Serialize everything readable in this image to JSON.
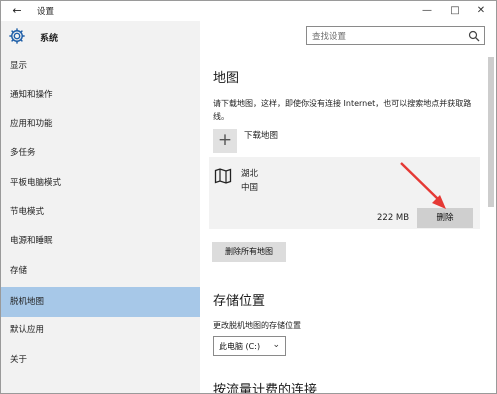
{
  "window": {
    "title": "设置",
    "controls": [
      "minimize",
      "maximize",
      "close"
    ]
  },
  "sidebar": {
    "header": "系统",
    "items": [
      {
        "label": "显示"
      },
      {
        "label": "通知和操作"
      },
      {
        "label": "应用和功能"
      },
      {
        "label": "多任务"
      },
      {
        "label": "平板电脑模式"
      },
      {
        "label": "节电模式"
      },
      {
        "label": "电源和睡眠"
      },
      {
        "label": "存储"
      },
      {
        "label": "脱机地图",
        "active": true
      },
      {
        "label": "默认应用"
      },
      {
        "label": "关于"
      }
    ]
  },
  "search": {
    "placeholder": "查找设置"
  },
  "maps": {
    "heading": "地图",
    "description": "请下载地图，这样，即使你没有连接 Internet，也可以搜索地点并获取路线。",
    "download_label": "下载地图",
    "card": {
      "region": "湖北",
      "country": "中国",
      "size": "222 MB",
      "delete_label": "删除"
    },
    "delete_all_label": "删除所有地图"
  },
  "storage": {
    "heading": "存储位置",
    "label": "更改脱机地图的存储位置",
    "selected": "此电脑 (C:)"
  },
  "next_section": {
    "heading": "按流量计费的连接"
  },
  "colors": {
    "sidebar_bg": "#f2f2f2",
    "active_item": "#a7c8e8",
    "annotation_arrow": "#e53935"
  }
}
